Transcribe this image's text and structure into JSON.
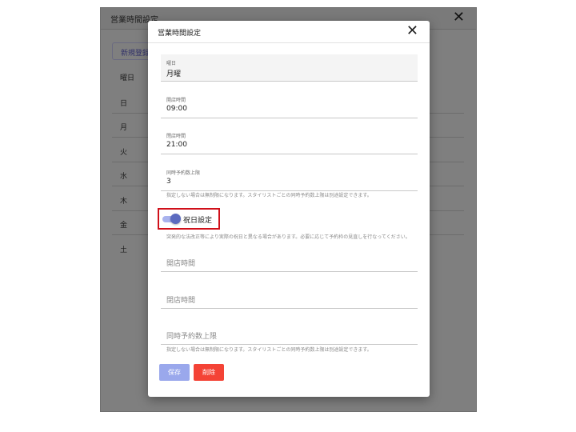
{
  "background_window": {
    "title": "営業時間設定",
    "close_glyph": "✕",
    "new_button": "新規登録",
    "column_header": "曜日",
    "rows": [
      "日",
      "月",
      "火",
      "水",
      "木",
      "金",
      "土"
    ]
  },
  "dialog": {
    "title": "営業時間設定",
    "close_glyph": "✕",
    "weekday": {
      "label": "曜日",
      "value": "月曜"
    },
    "open_time": {
      "label": "開店時間",
      "value": "09:00"
    },
    "close_time": {
      "label": "閉店時間",
      "value": "21:00"
    },
    "max_reservations": {
      "label": "同時予約数上限",
      "value": "3"
    },
    "max_reservations_helper": "指定しない場合は無制限になります。スタイリストごとの同時予約数上限は別途設定できます。",
    "holiday": {
      "label": "祝日設定",
      "enabled": true
    },
    "holiday_helper": "突発的な法改正等により実際の祝日と異なる場合があります。必要に応じて予約枠の見直しを行なってください。",
    "holiday_open_time": {
      "placeholder": "開店時間"
    },
    "holiday_close_time": {
      "placeholder": "閉店時間"
    },
    "holiday_max_reservations": {
      "placeholder": "同時予約数上限"
    },
    "holiday_max_helper": "指定しない場合は無制限になります。スタイリストごとの同時予約数上限は別途設定できます。",
    "save_label": "保存",
    "delete_label": "削除"
  },
  "colors": {
    "accent": "#5c6bc0",
    "save_button": "#9aa8ec",
    "delete_button": "#f44336",
    "highlight_border": "#d0101a"
  }
}
